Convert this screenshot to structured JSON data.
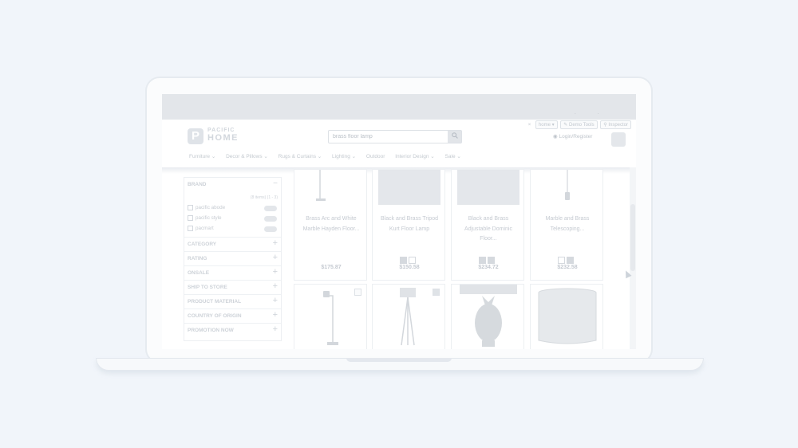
{
  "browser": {
    "dots": "· ·"
  },
  "header": {
    "logo_mark": "P",
    "logo_line1": "PACIFIC",
    "logo_line2": "HOME",
    "search_value": "brass floor lamp",
    "search_icon": "search-icon",
    "close_mark": "×",
    "tools": {
      "home": "home",
      "demo_tools": "Demo Tools",
      "inspector": "Inspector"
    },
    "login": "Login/Register"
  },
  "nav": [
    "Furniture ⌄",
    "Decor & Pillows ⌄",
    "Rugs & Curtains ⌄",
    "Lighting ⌄",
    "Outdoor",
    "Interior Design ⌄",
    "Sale ⌄"
  ],
  "sidebar": {
    "brand_heading": "BRAND",
    "brand_range": "(8 items) (1 - 3)",
    "brands": [
      "pacific abode",
      "pacific style",
      "pacmart"
    ],
    "facets": [
      "CATEGORY",
      "RATING",
      "ONSALE",
      "SHIP TO STORE",
      "PRODUCT MATERIAL",
      "COUNTRY OF ORIGIN",
      "PROMOTION NOW"
    ]
  },
  "products": [
    {
      "title": "Brass Arc and White Marble Hayden Floor...",
      "price": "$175.87",
      "swatches": []
    },
    {
      "title": "Black and Brass Tripod Kurt Floor Lamp",
      "price": "$150.58",
      "swatches": [
        "dark",
        "light"
      ]
    },
    {
      "title": "Black and Brass Adjustable Dominic Floor...",
      "price": "$234.72",
      "swatches": [
        "dark",
        "dark"
      ]
    },
    {
      "title": "Marble and Brass Telescoping...",
      "price": "$232.58",
      "swatches": [
        "light",
        "dark"
      ]
    }
  ],
  "colors": {
    "page_bg": "#f1f5fa",
    "muted_text": "#c5cad1",
    "product_image": "#e4e7eb"
  }
}
